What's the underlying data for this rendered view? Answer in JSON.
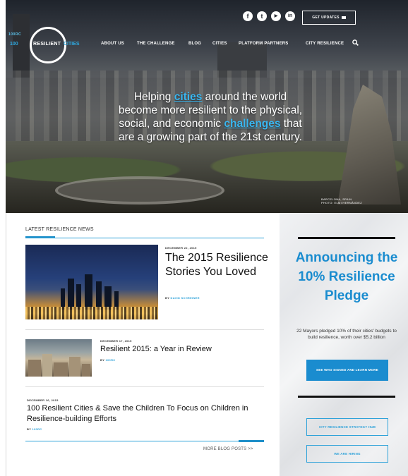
{
  "brand": {
    "top_label": "100RC",
    "prefix": "100",
    "name": "RESILIENT",
    "suffix": "CITIES"
  },
  "social": {
    "icons": [
      "facebook-icon",
      "twitter-icon",
      "youtube-icon",
      "linkedin-icon"
    ],
    "glyphs": [
      "f",
      "t",
      "▶",
      "in"
    ]
  },
  "header": {
    "updates_label": "GET UPDATES"
  },
  "nav": {
    "items": [
      "ABOUT US",
      "THE CHALLENGE",
      "BLOG",
      "CITIES",
      "PLATFORM PARTNERS",
      "CITY RESILIENCE"
    ]
  },
  "hero": {
    "line1_pre": "Helping ",
    "line1_link": "cities",
    "line1_post": " around the world",
    "line2": "become more resilient to the physical,",
    "line3_pre": "social, and economic ",
    "line3_link": "challenges",
    "line3_post": " that",
    "line4": "are a growing part of the 21st century.",
    "caption_line1": "BARCELONA, SPAIN",
    "caption_line2": "PHOTO: ELMI HERNÁNDEZ"
  },
  "news": {
    "header": "LATEST RESILIENCE NEWS",
    "items": [
      {
        "date": "DECEMBER 22, 2015",
        "title": "The 2015 Resilience Stories You Loved",
        "by": "BY ",
        "author": "DAVID SCHREINER"
      },
      {
        "date": "DECEMBER 17, 2015",
        "title": "Resilient 2015: a Year in Review",
        "by": "BY ",
        "author": "100RC"
      },
      {
        "date": "DECEMBER 16, 2015",
        "title": "100 Resilient Cities & Save the Children To Focus on Children in Resilience-building Efforts",
        "by": "BY ",
        "author": "100RC"
      }
    ],
    "more_link": "MORE BLOG POSTS >>"
  },
  "pledge": {
    "title": "Announcing the 10% Resilience Pledge",
    "body": "22 Mayors pledged 10% of their cities' budgets to build resilience, worth over $5.2 billion",
    "cta_label": "SEE WHO SIGNED AND LEARN MORE",
    "hub_label": "CITY RESILIENCE STRATEGY HUB",
    "hiring_label": "WE ARE HIRING"
  },
  "colors": {
    "accent": "#2ea2d9",
    "accent_dark": "#1a8ccf"
  }
}
